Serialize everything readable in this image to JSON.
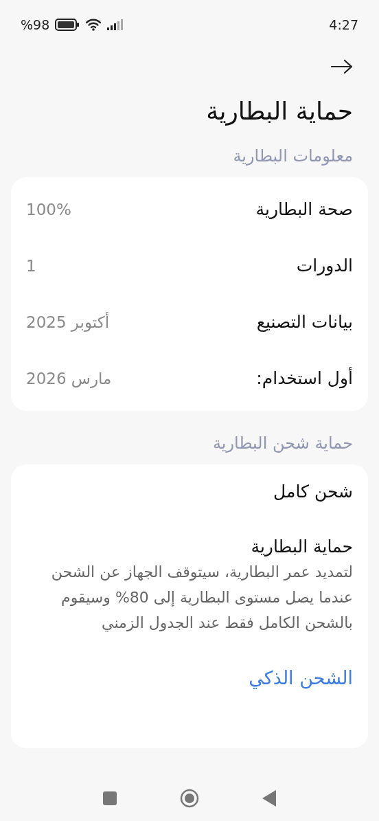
{
  "status_bar": {
    "battery_percent": "%98",
    "time": "4:27"
  },
  "title": "حماية البطارية",
  "sections": [
    {
      "header": "معلومات البطارية",
      "kind": "info",
      "rows": [
        {
          "label": "صحة البطارية",
          "value": "100%"
        },
        {
          "label": "الدورات",
          "value": "1"
        },
        {
          "label": "بيانات التصنيع",
          "value": "أكتوبر 2025"
        },
        {
          "label": "أول استخدام:",
          "value": "مارس 2026"
        }
      ]
    },
    {
      "header": "حماية شحن البطارية",
      "kind": "options",
      "items": [
        {
          "kind": "option",
          "title": "شحن كامل"
        },
        {
          "kind": "option",
          "title": "حماية البطارية",
          "description": "لتمديد عمر البطارية، سيتوقف الجهاز عن الشحن عندما يصل مستوى البطارية إلى 80% وسيقوم بالشحن الكامل فقط عند الجدول الزمني"
        },
        {
          "kind": "link",
          "title": "الشحن الذكي"
        }
      ]
    }
  ]
}
